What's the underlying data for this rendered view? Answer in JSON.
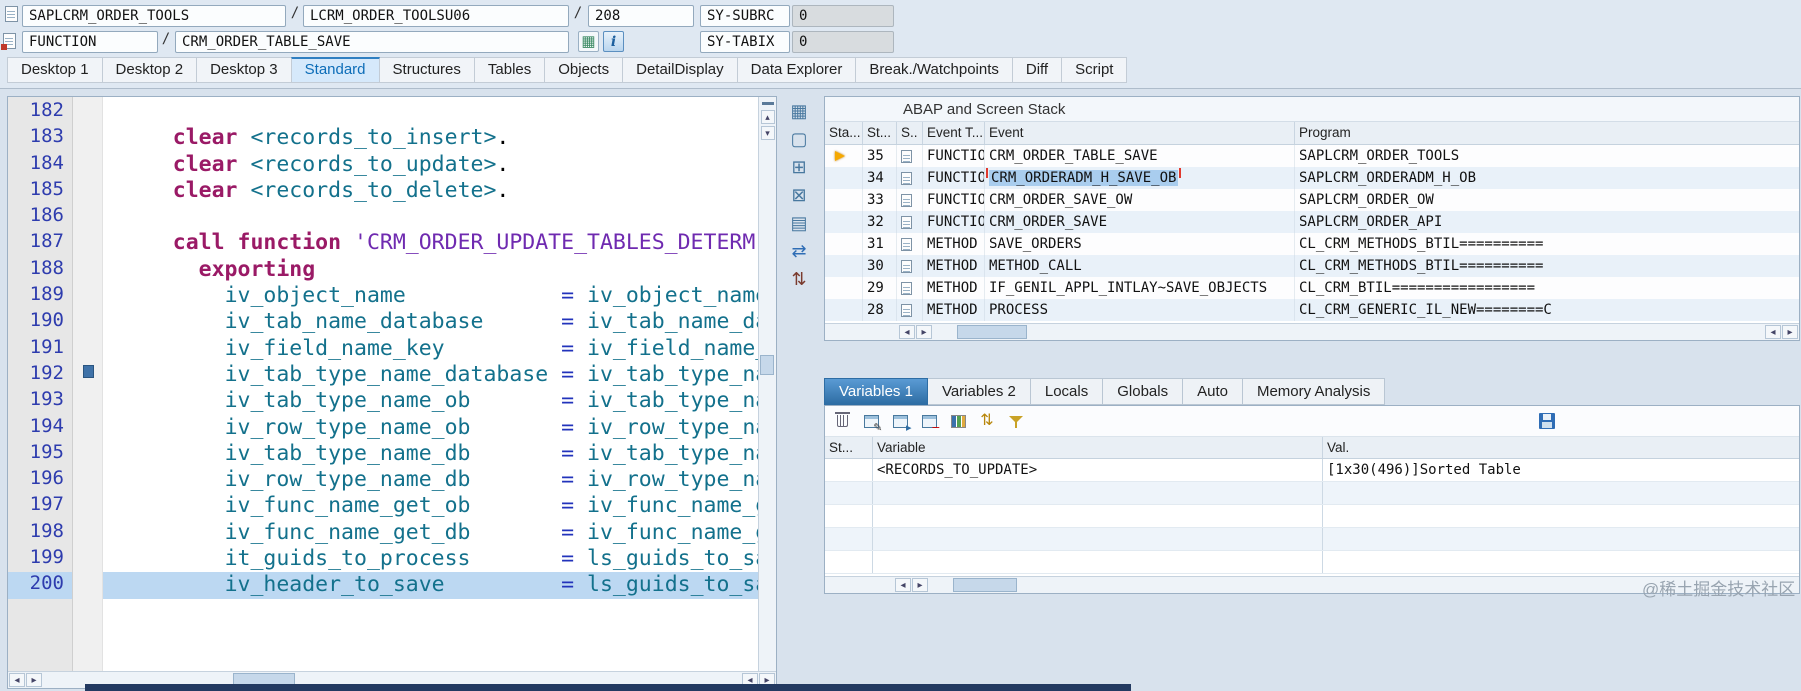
{
  "header": {
    "separator": "/",
    "row1": {
      "program": "SAPLCRM_ORDER_TOOLS",
      "include": "LCRM_ORDER_TOOLSU06",
      "line": "208",
      "sy_subrc_label": "SY-SUBRC",
      "sy_subrc_value": "0"
    },
    "row2": {
      "type": "FUNCTION",
      "name": "CRM_ORDER_TABLE_SAVE",
      "sy_tabix_label": "SY-TABIX",
      "sy_tabix_value": "0"
    }
  },
  "desktop_tabs": {
    "active": "Standard",
    "items": [
      "Desktop 1",
      "Desktop 2",
      "Desktop 3",
      "Standard",
      "Structures",
      "Tables",
      "Objects",
      "DetailDisplay",
      "Data Explorer",
      "Break./Watchpoints",
      "Diff",
      "Script"
    ]
  },
  "editor": {
    "lines": [
      {
        "n": "182",
        "tokens": []
      },
      {
        "n": "183",
        "tokens": [
          [
            "t",
            "    "
          ],
          [
            "k",
            "clear"
          ],
          [
            "t",
            " "
          ],
          [
            "i",
            "<records_to_insert>"
          ],
          [
            "t",
            "."
          ]
        ]
      },
      {
        "n": "184",
        "tokens": [
          [
            "t",
            "    "
          ],
          [
            "k",
            "clear"
          ],
          [
            "t",
            " "
          ],
          [
            "i",
            "<records_to_update>"
          ],
          [
            "t",
            "."
          ]
        ]
      },
      {
        "n": "185",
        "tokens": [
          [
            "t",
            "    "
          ],
          [
            "k",
            "clear"
          ],
          [
            "t",
            " "
          ],
          [
            "i",
            "<records_to_delete>"
          ],
          [
            "t",
            "."
          ]
        ]
      },
      {
        "n": "186",
        "tokens": []
      },
      {
        "n": "187",
        "tokens": [
          [
            "t",
            "    "
          ],
          [
            "k",
            "call function"
          ],
          [
            "t",
            " "
          ],
          [
            "s",
            "'CRM_ORDER_UPDATE_TABLES_DETERM"
          ]
        ]
      },
      {
        "n": "188",
        "tokens": [
          [
            "t",
            "      "
          ],
          [
            "k",
            "exporting"
          ]
        ]
      },
      {
        "n": "189",
        "tokens": [
          [
            "t",
            "        "
          ],
          [
            "i",
            "iv_object_name"
          ],
          [
            "t",
            "            "
          ],
          [
            "o",
            "="
          ],
          [
            "t",
            " "
          ],
          [
            "i",
            "iv_object_name"
          ]
        ]
      },
      {
        "n": "190",
        "tokens": [
          [
            "t",
            "        "
          ],
          [
            "i",
            "iv_tab_name_database"
          ],
          [
            "t",
            "      "
          ],
          [
            "o",
            "="
          ],
          [
            "t",
            " "
          ],
          [
            "i",
            "iv_tab_name_da"
          ]
        ]
      },
      {
        "n": "191",
        "tokens": [
          [
            "t",
            "        "
          ],
          [
            "i",
            "iv_field_name_key"
          ],
          [
            "t",
            "         "
          ],
          [
            "o",
            "="
          ],
          [
            "t",
            " "
          ],
          [
            "i",
            "iv_field_name_"
          ]
        ]
      },
      {
        "n": "192",
        "tokens": [
          [
            "t",
            "        "
          ],
          [
            "i",
            "iv_tab_type_name_database"
          ],
          [
            "t",
            " "
          ],
          [
            "o",
            "="
          ],
          [
            "t",
            " "
          ],
          [
            "i",
            "iv_tab_type_na"
          ]
        ]
      },
      {
        "n": "193",
        "tokens": [
          [
            "t",
            "        "
          ],
          [
            "i",
            "iv_tab_type_name_ob"
          ],
          [
            "t",
            "       "
          ],
          [
            "o",
            "="
          ],
          [
            "t",
            " "
          ],
          [
            "i",
            "iv_tab_type_na"
          ]
        ]
      },
      {
        "n": "194",
        "tokens": [
          [
            "t",
            "        "
          ],
          [
            "i",
            "iv_row_type_name_ob"
          ],
          [
            "t",
            "       "
          ],
          [
            "o",
            "="
          ],
          [
            "t",
            " "
          ],
          [
            "i",
            "iv_row_type_na"
          ]
        ]
      },
      {
        "n": "195",
        "tokens": [
          [
            "t",
            "        "
          ],
          [
            "i",
            "iv_tab_type_name_db"
          ],
          [
            "t",
            "       "
          ],
          [
            "o",
            "="
          ],
          [
            "t",
            " "
          ],
          [
            "i",
            "iv_tab_type_na"
          ]
        ]
      },
      {
        "n": "196",
        "tokens": [
          [
            "t",
            "        "
          ],
          [
            "i",
            "iv_row_type_name_db"
          ],
          [
            "t",
            "       "
          ],
          [
            "o",
            "="
          ],
          [
            "t",
            " "
          ],
          [
            "i",
            "iv_row_type_na"
          ]
        ]
      },
      {
        "n": "197",
        "tokens": [
          [
            "t",
            "        "
          ],
          [
            "i",
            "iv_func_name_get_ob"
          ],
          [
            "t",
            "       "
          ],
          [
            "o",
            "="
          ],
          [
            "t",
            " "
          ],
          [
            "i",
            "iv_func_name_g"
          ]
        ]
      },
      {
        "n": "198",
        "tokens": [
          [
            "t",
            "        "
          ],
          [
            "i",
            "iv_func_name_get_db"
          ],
          [
            "t",
            "       "
          ],
          [
            "o",
            "="
          ],
          [
            "t",
            " "
          ],
          [
            "i",
            "iv_func_name_g"
          ]
        ]
      },
      {
        "n": "199",
        "tokens": [
          [
            "t",
            "        "
          ],
          [
            "i",
            "it_guids_to_process"
          ],
          [
            "t",
            "       "
          ],
          [
            "o",
            "="
          ],
          [
            "t",
            " "
          ],
          [
            "i",
            "ls_guids_to_sa"
          ]
        ]
      },
      {
        "n": "200",
        "current": true,
        "tokens": [
          [
            "t",
            "        "
          ],
          [
            "i",
            "iv_header_to_save"
          ],
          [
            "t",
            "         "
          ],
          [
            "o",
            "="
          ],
          [
            "t",
            " "
          ],
          [
            "i",
            "ls_guids_to_sa"
          ]
        ]
      }
    ]
  },
  "tool_strip": [
    {
      "name": "replace-tool-icon",
      "glyph": "▦",
      "color": "#48789f"
    },
    {
      "name": "new-tool-icon",
      "glyph": "▢",
      "color": "#48789f"
    },
    {
      "name": "split-screen-icon",
      "glyph": "⊞",
      "color": "#48789f"
    },
    {
      "name": "close-tool-icon",
      "glyph": "⊠",
      "color": "#48789f"
    },
    {
      "name": "table-tool-icon",
      "glyph": "▤",
      "color": "#48789f"
    },
    {
      "name": "swap-tool-icon",
      "glyph": "⇄",
      "color": "#2f6db5"
    },
    {
      "name": "sort-tool-icon",
      "glyph": "⇅",
      "color": "#7a3b2e"
    }
  ],
  "stack_panel": {
    "title": "ABAP and Screen Stack",
    "columns": [
      "Sta...",
      "St...",
      "S..",
      "Event T...",
      "Event",
      "Program"
    ],
    "rows": [
      {
        "pointer": true,
        "level": "35",
        "type": "FUNCTIO",
        "event": "CRM_ORDER_TABLE_SAVE",
        "program": "SAPLCRM_ORDER_TOOLS"
      },
      {
        "level": "34",
        "type": "FUNCTIO",
        "event": "CRM_ORDERADM_H_SAVE_OB",
        "program": "SAPLCRM_ORDERADM_H_OB",
        "selected": true
      },
      {
        "level": "33",
        "type": "FUNCTIO",
        "event": "CRM_ORDER_SAVE_OW",
        "program": "SAPLCRM_ORDER_OW"
      },
      {
        "level": "32",
        "type": "FUNCTIO",
        "event": "CRM_ORDER_SAVE",
        "program": "SAPLCRM_ORDER_API"
      },
      {
        "level": "31",
        "type": "METHOD",
        "event": "SAVE_ORDERS",
        "program": "CL_CRM_METHODS_BTIL=========="
      },
      {
        "level": "30",
        "type": "METHOD",
        "event": "METHOD_CALL",
        "program": "CL_CRM_METHODS_BTIL=========="
      },
      {
        "level": "29",
        "type": "METHOD",
        "event": "IF_GENIL_APPL_INTLAY~SAVE_OBJECTS",
        "program": "CL_CRM_BTIL================="
      },
      {
        "level": "28",
        "type": "METHOD",
        "event": "PROCESS",
        "program": "CL_CRM_GENERIC_IL_NEW========C"
      }
    ]
  },
  "variables_panel": {
    "active_tab": "Variables 1",
    "tabs": [
      "Variables 1",
      "Variables 2",
      "Locals",
      "Globals",
      "Auto",
      "Memory Analysis"
    ],
    "toolbar": [
      {
        "name": "delete-variable-icon",
        "kind": "trash"
      },
      {
        "name": "edit-table-icon",
        "kind": "tbl",
        "overlay": "✎",
        "ovl_color": "#444444"
      },
      {
        "name": "export-table-icon",
        "kind": "tbl",
        "overlay": "▸",
        "ovl_color": "#2e6da4"
      },
      {
        "name": "remove-rows-icon",
        "kind": "tbl",
        "overlay": "−",
        "ovl_color": "#cc0000"
      },
      {
        "name": "columns-icon",
        "kind": "cols"
      },
      {
        "name": "sort-values-icon",
        "kind": "glyph",
        "glyph": "⇅",
        "color": "#b8860b"
      },
      {
        "name": "filter-icon",
        "kind": "funnel"
      }
    ],
    "save_icon_name": "save-layout-icon",
    "columns": [
      "St...",
      "Variable",
      "Val."
    ],
    "rows": [
      {
        "variable": "<RECORDS_TO_UPDATE>",
        "value": "[1x30(496)]Sorted Table"
      },
      {
        "variable": "",
        "value": ""
      },
      {
        "variable": "",
        "value": ""
      },
      {
        "variable": "",
        "value": ""
      },
      {
        "variable": "",
        "value": ""
      }
    ]
  },
  "watermark": "@稀土掘金技术社区"
}
